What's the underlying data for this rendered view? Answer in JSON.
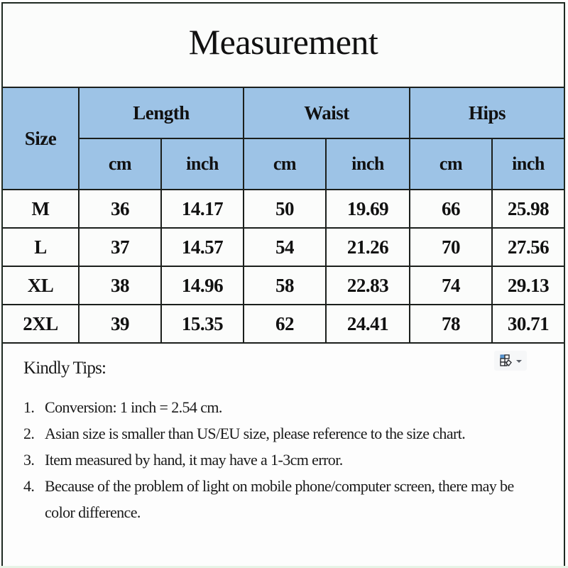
{
  "title": "Measurement",
  "table": {
    "size_header": "Size",
    "groups": [
      {
        "label": "Length",
        "units": [
          "cm",
          "inch"
        ]
      },
      {
        "label": "Waist",
        "units": [
          "cm",
          "inch"
        ]
      },
      {
        "label": "Hips",
        "units": [
          "cm",
          "inch"
        ]
      }
    ],
    "rows": [
      {
        "size": "M",
        "values": [
          "36",
          "14.17",
          "50",
          "19.69",
          "66",
          "25.98"
        ]
      },
      {
        "size": "L",
        "values": [
          "37",
          "14.57",
          "54",
          "21.26",
          "70",
          "27.56"
        ]
      },
      {
        "size": "XL",
        "values": [
          "38",
          "14.96",
          "58",
          "22.83",
          "74",
          "29.13"
        ]
      },
      {
        "size": "2XL",
        "values": [
          "39",
          "15.35",
          "62",
          "24.41",
          "78",
          "30.71"
        ]
      }
    ]
  },
  "tips": {
    "title": "Kindly Tips:",
    "items": [
      {
        "num": "1.",
        "text": "Conversion: 1 inch = 2.54 cm."
      },
      {
        "num": "2.",
        "text": "Asian size is smaller than US/EU size, please reference to the size chart."
      },
      {
        "num": "3.",
        "text": "Item measured by hand, it may have a 1-3cm error."
      },
      {
        "num": "4.",
        "text": "Because of the problem of light on mobile phone/computer screen, there may be color difference."
      }
    ]
  },
  "paste_options": {
    "icon": "paste-options-icon",
    "accent": "#5b9bd5"
  },
  "colors": {
    "header_fill": "#9dc3e6",
    "border": "#1b1f1c"
  }
}
